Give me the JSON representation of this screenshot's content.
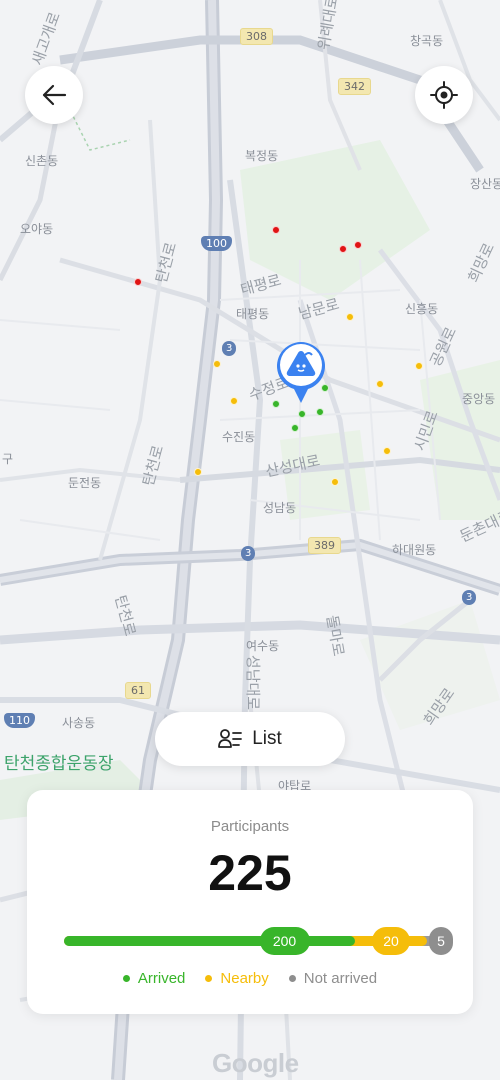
{
  "header": {
    "back_icon": "arrow-left-icon",
    "locate_icon": "crosshair-icon"
  },
  "map": {
    "labels": {
      "l1": "신촌동",
      "l2": "오야동",
      "l3": "복정동",
      "l4": "창곡동",
      "l5": "태평로",
      "l6": "태평동",
      "l7": "남문로",
      "l8": "신흥동",
      "l9": "공원로",
      "l10": "희망로",
      "l11": "중앙동",
      "l12": "수정로",
      "l13": "수진동",
      "l14": "산성대로",
      "l15": "시민로",
      "l16": "탄천로",
      "l17": "둔전동",
      "l18": "성남동",
      "l19": "하대원동",
      "l20": "둔촌대로",
      "l21": "탄천로",
      "l22": "여수동",
      "l23": "돌마로",
      "l24": "희망로",
      "l25": "사송동",
      "l26": "탄천종합운동장",
      "l27": "야탑로",
      "l28": "위례대로",
      "l29": "탄천로",
      "l30": "새고개로",
      "l31": "구",
      "l32": "장산동",
      "l33": "성남대로"
    },
    "shields": {
      "r308": "308",
      "r342": "342",
      "r100": "100",
      "r3a": "3",
      "r3b": "3",
      "r389": "389",
      "r3c": "3",
      "r61": "61",
      "r110": "110"
    },
    "markers": {
      "arrived_color": "#38b52a",
      "nearby_color": "#f5bd0a",
      "not_arrived_color": "#e01414"
    },
    "pin_icon": "user-location-pin-icon",
    "attribution": "Google"
  },
  "list_button": {
    "icon": "user-list-icon",
    "label": "List"
  },
  "summary": {
    "title": "Participants",
    "total": "225",
    "arrived": {
      "count": "200",
      "value": 200,
      "color": "#38b52a"
    },
    "nearby": {
      "count": "20",
      "value": 20,
      "color": "#f5bd0a"
    },
    "not_arrived": {
      "count": "5",
      "value": 5,
      "color": "#8e8e8e"
    },
    "legend": {
      "arrived": "Arrived",
      "nearby": "Nearby",
      "not_arrived": "Not arrived"
    }
  }
}
